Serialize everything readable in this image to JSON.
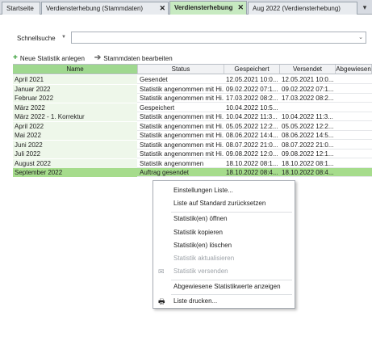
{
  "tabs": [
    {
      "label": "Startseite",
      "closable": false
    },
    {
      "label": "Verdiensterhebung (Stammdaten)",
      "closable": true
    },
    {
      "label": "Verdiensterhebung",
      "closable": true,
      "active": true
    },
    {
      "label": "Aug 2022 (Verdiensterhebung)",
      "closable": false
    }
  ],
  "search": {
    "label": "Schnellsuche",
    "value": ""
  },
  "toolbar": {
    "new_label": "Neue Statistik anlegen",
    "edit_label": "Stammdaten bearbeiten"
  },
  "columns": [
    "Name",
    "Status",
    "Gespeichert",
    "Versendet",
    "Abgewiesen"
  ],
  "rows": [
    [
      "April 2021",
      "Gesendet",
      "12.05.2021 10:0...",
      "12.05.2021 10:0...",
      ""
    ],
    [
      "Januar 2022",
      "Statistik angenommen mit Hi...",
      "09.02.2022 07:1...",
      "09.02.2022 07:1...",
      ""
    ],
    [
      "Februar 2022",
      "Statistik angenommen mit Hi...",
      "17.03.2022 08:2...",
      "17.03.2022 08:2...",
      ""
    ],
    [
      "März 2022",
      "Gespeichert",
      "10.04.2022 10:5...",
      "",
      ""
    ],
    [
      "März 2022 - 1. Korrektur",
      "Statistik angenommen mit Hi...",
      "10.04.2022 11:3...",
      "10.04.2022 11:3...",
      ""
    ],
    [
      "April 2022",
      "Statistik angenommen mit Hi...",
      "05.05.2022 12:2...",
      "05.05.2022 12:2...",
      ""
    ],
    [
      "Mai 2022",
      "Statistik angenommen mit Hi...",
      "08.06.2022 14:4...",
      "08.06.2022 14:5...",
      ""
    ],
    [
      "Juni 2022",
      "Statistik angenommen mit Hi...",
      "08.07.2022 21:0...",
      "08.07.2022 21:0...",
      ""
    ],
    [
      "Juli 2022",
      "Statistik angenommen mit Hi...",
      "09.08.2022 12:0...",
      "09.08.2022 12:1...",
      ""
    ],
    [
      "August 2022",
      "Statistik angenommen",
      "18.10.2022 08:1...",
      "18.10.2022 08:1...",
      ""
    ],
    [
      "September 2022",
      "Auftrag gesendet",
      "18.10.2022 08:4...",
      "18.10.2022 08:4...",
      ""
    ]
  ],
  "selected_row": 10,
  "context_menu": [
    {
      "label": "Einstellungen Liste...",
      "icon": "",
      "disabled": false
    },
    {
      "label": "Liste auf Standard zurücksetzen",
      "icon": "",
      "disabled": false
    },
    {
      "label": "Statistik(en) öffnen",
      "icon": "",
      "disabled": false
    },
    {
      "label": "Statistik kopieren",
      "icon": "",
      "disabled": false
    },
    {
      "label": "Statistik(en) löschen",
      "icon": "",
      "disabled": false
    },
    {
      "label": "Statistik aktualisieren",
      "icon": "",
      "disabled": true
    },
    {
      "label": "Statistik versenden",
      "icon": "send-icon",
      "disabled": true
    },
    {
      "label": "Abgewiesene Statistikwerte anzeigen",
      "icon": "",
      "disabled": false
    },
    {
      "label": "Liste drucken...",
      "icon": "printer-icon",
      "disabled": false
    }
  ],
  "colors": {
    "accent": "#9fd88f",
    "selected_row": "#a6dc8c",
    "tab_bar": "#d7dbe2"
  }
}
